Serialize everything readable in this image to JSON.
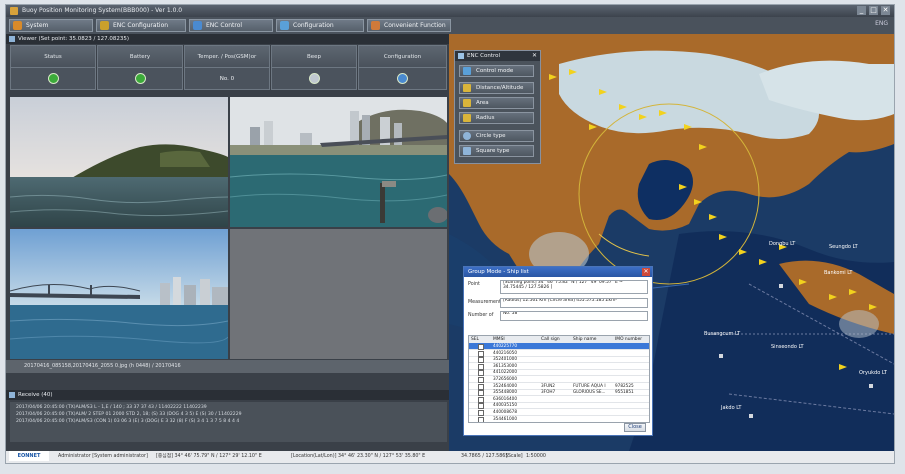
{
  "window": {
    "title": "Buoy Position Monitoring System(BBB000) - Ver 1.0.0",
    "controls": [
      "_",
      "□",
      "✕"
    ]
  },
  "menu": {
    "items": [
      {
        "label": "System",
        "color": "#d88a2a"
      },
      {
        "label": "ENC Configuration",
        "color": "#c9a02c"
      },
      {
        "label": "ENC Control",
        "color": "#4a8ad0"
      },
      {
        "label": "Configuration",
        "color": "#5aa0d8"
      },
      {
        "label": "Convenient Function",
        "color": "#d07a3a"
      }
    ],
    "right_text": "ENG"
  },
  "viewer": {
    "title": "Viewer (Set point: 35.0823 / 127.08235)",
    "columns": [
      {
        "label": "Status",
        "value": "",
        "indicator": "#3cab3a"
      },
      {
        "label": "Battery",
        "value": "",
        "indicator": "#3cab3a"
      },
      {
        "label": "Temper. / Pos(GSM)or",
        "value": "No. 0",
        "indicator": ""
      },
      {
        "label": "Beep",
        "value": "",
        "indicator": "#c0c8d0"
      },
      {
        "label": "Configuration",
        "value": "",
        "indicator": "#4a8ad0"
      }
    ],
    "file_line": "20170416_085158,20170416_2055 0.jpg (h 0448) / 20170416"
  },
  "receive": {
    "title": "Receive (40)",
    "lines": [
      "2017/04/06 20:45:00 (TX)ALM/S3 L - 1,E / 140 ; 33 37 37 43 / 11402222 11402239",
      "2017/04/06 20:45:00 (TX)ALM/ 2 STEP 01 2000 STD 2, 18; (S) 33 (DOG 4 3 5) E (S) 30 / 11402229",
      "2017/04/06 20:45:00 (TX)ALM/S3 (CON 1) 03 06 3 (E) 3 (DOG) E 3 32 (8) F (S) 3 4 1 3 7 5 8 4 4 4"
    ]
  },
  "enc_control": {
    "title": "ENC Control",
    "buttons": [
      {
        "label": "Control mode",
        "color": "#5aa0d8"
      },
      {
        "label": "Distance/Altitude",
        "color": "#d9b53a"
      },
      {
        "label": "Area",
        "color": "#d9b53a"
      },
      {
        "label": "Radius",
        "color": "#d9b53a"
      },
      {
        "label": "Circle type",
        "color": "#8fb4d8"
      },
      {
        "label": "Square type",
        "color": "#8fb4d8"
      }
    ]
  },
  "map": {
    "labels": [
      "Dongbu LT",
      "Bankomi LT",
      "Busangcum LT",
      "Sinseondo LT",
      "Jakdo LT",
      "Oryukdo LT",
      "Seungdo LT"
    ]
  },
  "group_mode": {
    "title": "Group Mode - Ship list",
    "point_label": "Point",
    "point_value": "[Starting point] 34° 46' 75.82\" N / 127° 49' 09.57\" E ~ 34.75445 / 127.5826 ]",
    "measurement_label": "Measurement",
    "measurement_value": "[Radius] 12.561 Km   [Circle area] 455.575.185 Zkm²",
    "number_label": "Number of",
    "number_value": "No. 58",
    "columns": [
      "SEL",
      "MMSI",
      "Call sign",
      "Ship name",
      "IMO number"
    ],
    "rows": [
      {
        "mmsi": "440225770",
        "call": "",
        "name": "",
        "imo": "",
        "selected": true
      },
      {
        "mmsi": "440216050",
        "call": "",
        "name": "",
        "imo": "",
        "selected": false
      },
      {
        "mmsi": "352401000",
        "call": "",
        "name": "",
        "imo": "",
        "selected": false
      },
      {
        "mmsi": "361353000",
        "call": "",
        "name": "",
        "imo": "",
        "selected": false
      },
      {
        "mmsi": "441022000",
        "call": "",
        "name": "",
        "imo": "",
        "selected": false
      },
      {
        "mmsi": "372656000",
        "call": "",
        "name": "",
        "imo": "",
        "selected": false
      },
      {
        "mmsi": "352464000",
        "call": "3FUN2",
        "name": "FUTURE AQUA I",
        "imo": "9782525",
        "selected": false
      },
      {
        "mmsi": "355448000",
        "call": "3FOH7",
        "name": "GLORIOUS SE...",
        "imo": "9551851",
        "selected": false
      },
      {
        "mmsi": "636016400",
        "call": "",
        "name": "",
        "imo": "",
        "selected": false
      },
      {
        "mmsi": "440035150",
        "call": "",
        "name": "",
        "imo": "",
        "selected": false
      },
      {
        "mmsi": "440008678",
        "call": "",
        "name": "",
        "imo": "",
        "selected": false
      },
      {
        "mmsi": "354461000",
        "call": "",
        "name": "",
        "imo": "",
        "selected": false
      }
    ],
    "close_label": "Close"
  },
  "statusbar": {
    "logo": "EONNET",
    "user": "Administrator [System administrator]",
    "center": "[중심점] 34° 46' 75.79\" N / 127° 29' 12.10\" E",
    "location": "[Location(Lat/Lon)] 34° 46' 23.30\" N / 127° 53' 35.80\" E",
    "lat_lon": "34.7865 / 127.5865",
    "scale_label": "[Scale]",
    "scale_value": "1:50000"
  }
}
